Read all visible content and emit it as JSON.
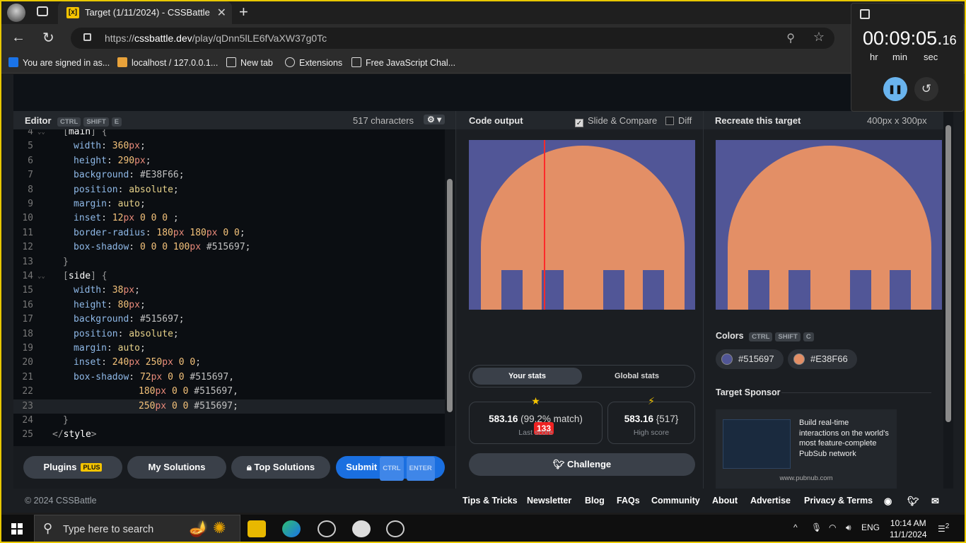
{
  "browser": {
    "tab_title": "Target (1/11/2024) - CSSBattle",
    "tab_favicon": "[x]",
    "url_prefix": "https://",
    "url_domain": "cssbattle.dev",
    "url_path": "/play/qDnn5lLE6fVaXW37g0Tc",
    "bookmarks": [
      "You are signed in as...",
      "localhost / 127.0.0.1...",
      "New tab",
      "Extensions",
      "Free JavaScript Chal..."
    ]
  },
  "editor": {
    "title": "Editor",
    "shortcut": [
      "CTRL",
      "SHIFT",
      "E"
    ],
    "char_count": "517 characters",
    "lines": [
      {
        "n": "4",
        "fold": "⌄",
        "html": "<span class='brk'>[</span><span class='sel'>main</span><span class='brk'>] {</span>",
        "indent": 1
      },
      {
        "n": "5",
        "html": "<span class='prop'>width</span>: <span class='num'>360</span><span class='unit'>px</span>;",
        "indent": 2
      },
      {
        "n": "6",
        "html": "<span class='prop'>height</span>: <span class='num'>290</span><span class='unit'>px</span>;",
        "indent": 2
      },
      {
        "n": "7",
        "html": "<span class='prop'>background</span>: <span class='hex'>#E38F66</span>;",
        "indent": 2
      },
      {
        "n": "8",
        "html": "<span class='prop'>position</span>: <span class='kw'>absolute</span>;",
        "indent": 2
      },
      {
        "n": "9",
        "html": "<span class='prop'>margin</span>: <span class='kw'>auto</span>;",
        "indent": 2
      },
      {
        "n": "10",
        "html": "<span class='prop'>inset</span>: <span class='num'>12</span><span class='unit'>px</span> <span class='num'>0</span> <span class='num'>0</span> <span class='num'>0</span> ;",
        "indent": 2
      },
      {
        "n": "11",
        "html": "<span class='prop'>border-radius</span>: <span class='num'>180</span><span class='unit'>px</span> <span class='num'>180</span><span class='unit'>px</span> <span class='num'>0</span> <span class='num'>0</span>;",
        "indent": 2
      },
      {
        "n": "12",
        "html": "<span class='prop'>box-shadow</span>: <span class='num'>0</span> <span class='num'>0</span> <span class='num'>0</span> <span class='num'>100</span><span class='unit'>px</span> <span class='hex'>#515697</span>;",
        "indent": 2
      },
      {
        "n": "13",
        "html": "<span class='brk'>}</span>",
        "indent": 1
      },
      {
        "n": "14",
        "fold": "⌄",
        "html": "<span class='brk'>[</span><span class='sel'>side</span><span class='brk'>] {</span>",
        "indent": 1
      },
      {
        "n": "15",
        "html": "<span class='prop'>width</span>: <span class='num'>38</span><span class='unit'>px</span>;",
        "indent": 2
      },
      {
        "n": "16",
        "html": "<span class='prop'>height</span>: <span class='num'>80</span><span class='unit'>px</span>;",
        "indent": 2
      },
      {
        "n": "17",
        "html": "<span class='prop'>background</span>: <span class='hex'>#515697</span>;",
        "indent": 2
      },
      {
        "n": "18",
        "html": "<span class='prop'>position</span>: <span class='kw'>absolute</span>;",
        "indent": 2
      },
      {
        "n": "19",
        "html": "<span class='prop'>margin</span>: <span class='kw'>auto</span>;",
        "indent": 2
      },
      {
        "n": "20",
        "html": "<span class='prop'>inset</span>: <span class='num'>240</span><span class='unit'>px</span> <span class='num'>250</span><span class='unit'>px</span> <span class='num'>0</span> <span class='num'>0</span>;",
        "indent": 2
      },
      {
        "n": "21",
        "html": "<span class='prop'>box-shadow</span>: <span class='num'>72</span><span class='unit'>px</span> <span class='num'>0</span> <span class='num'>0</span> <span class='hex'>#515697</span>,",
        "indent": 2
      },
      {
        "n": "22",
        "html": "<span class='num'>180</span><span class='unit'>px</span> <span class='num'>0</span> <span class='num'>0</span> <span class='hex'>#515697</span>,",
        "indent": 3
      },
      {
        "n": "23",
        "html": "<span class='num'>250</span><span class='unit'>px</span> <span class='num'>0</span> <span class='num'>0</span> <span class='hex'>#515697</span>;",
        "indent": 3,
        "current": true
      },
      {
        "n": "24",
        "html": "<span class='brk'>}</span>",
        "indent": 1
      },
      {
        "n": "25",
        "html": "<span class='brk'>&lt;/</span><span class='tag'>style</span><span class='brk'>&gt;</span>",
        "indent": 0
      }
    ]
  },
  "buttons": {
    "plugins": "Plugins",
    "plugins_badge": "PLUS",
    "my_solutions": "My Solutions",
    "top_solutions": "Top Solutions",
    "submit": "Submit",
    "submit_keys": [
      "CTRL",
      "ENTER"
    ]
  },
  "output": {
    "title": "Code output",
    "slide_compare": "Slide & Compare",
    "diff": "Diff",
    "slider_value": "133",
    "tabs": [
      "Your stats",
      "Global stats"
    ],
    "last_score_value": "583.16",
    "last_score_match": "(99.2% match)",
    "last_score_label": "Last score",
    "high_score_value": "583.16",
    "high_score_chars": "{517}",
    "high_score_label": "High score",
    "challenge": "Challenge"
  },
  "target": {
    "title": "Recreate this target",
    "size": "400px x 300px",
    "colors_title": "Colors",
    "colors_keys": [
      "CTRL",
      "SHIFT",
      "C"
    ],
    "colors": [
      "#515697",
      "#E38F66"
    ],
    "sponsor_title": "Target Sponsor",
    "sponsor_text": "Build real-time interactions on the world's most feature-complete PubSub network",
    "sponsor_url": "www.pubnub.com"
  },
  "footer": {
    "copyright": "© 2024 CSSBattle",
    "links": [
      "Tips & Tricks",
      "Newsletter",
      "Blog",
      "FAQs",
      "Community",
      "About",
      "Advertise",
      "Privacy & Terms"
    ]
  },
  "timer": {
    "time_main": "00:09:05.",
    "time_frac": "16",
    "labels": [
      "hr",
      "min",
      "sec"
    ]
  },
  "taskbar": {
    "search_placeholder": "Type here to search",
    "lang": "ENG",
    "time": "10:14 AM",
    "date": "11/1/2024",
    "notifications": "2"
  }
}
